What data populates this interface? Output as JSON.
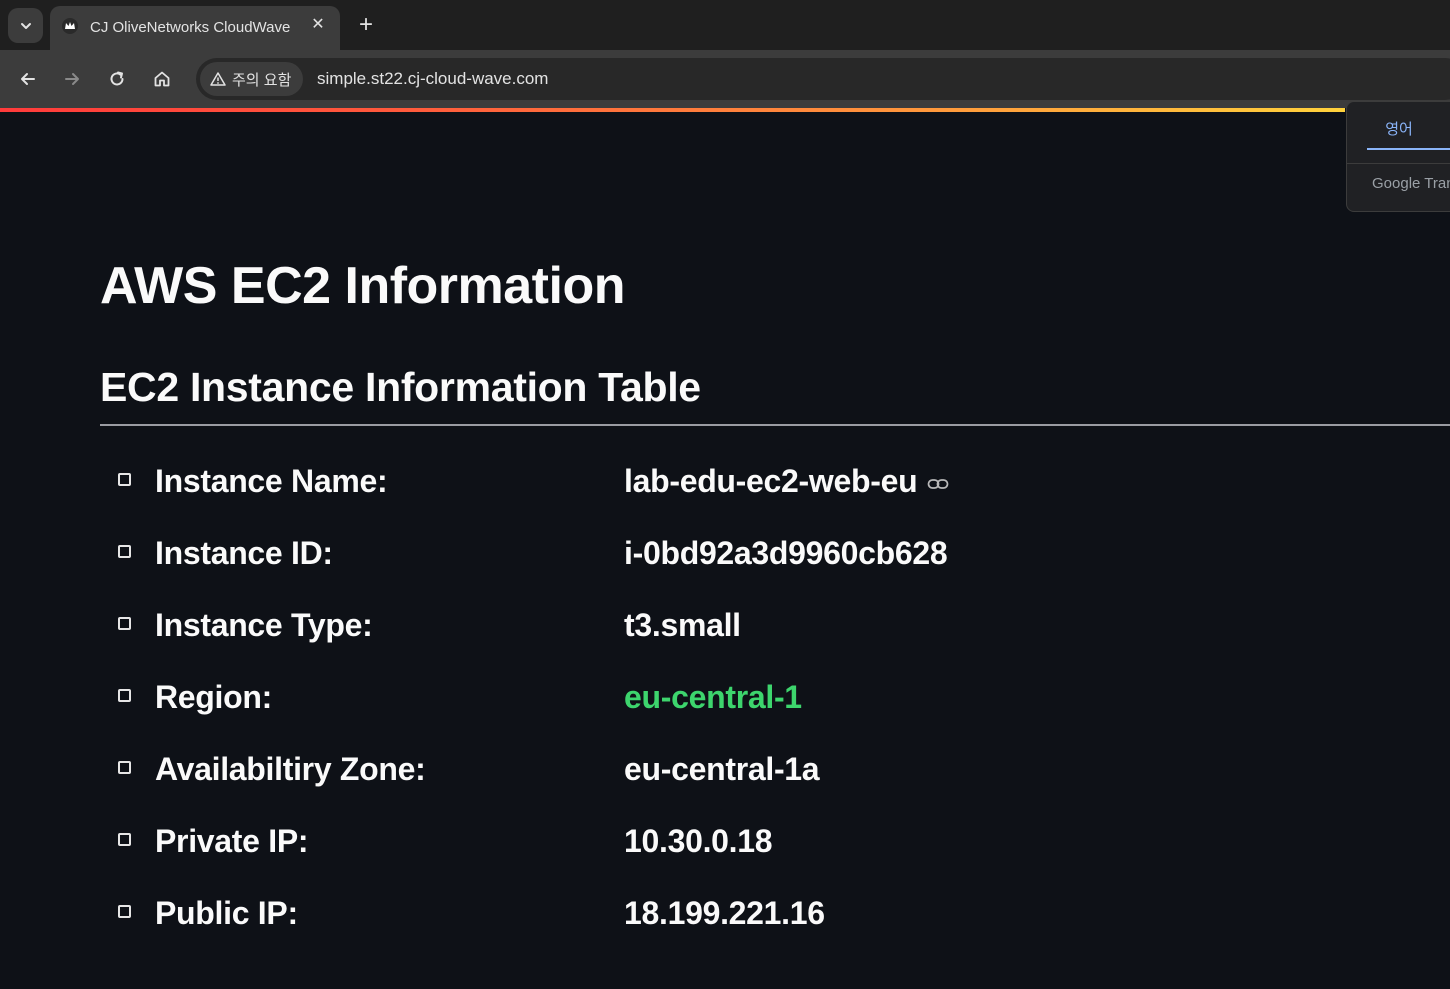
{
  "browser": {
    "tab_title": "CJ OliveNetworks CloudWave",
    "new_tab_label": "+",
    "close_label": "✕",
    "security_chip": "주의 요함",
    "url": "simple.st22.cj-cloud-wave.com"
  },
  "translate_popup": {
    "language": "영어",
    "brand": "Google Translate"
  },
  "page": {
    "title": "AWS EC2 Information",
    "section_title": "EC2 Instance Information Table",
    "rows": [
      {
        "label": "Instance Name:",
        "value": "lab-edu-ec2-web-eu"
      },
      {
        "label": "Instance ID:",
        "value": "i-0bd92a3d9960cb628"
      },
      {
        "label": "Instance Type:",
        "value": "t3.small"
      },
      {
        "label": "Region:",
        "value": "eu-central-1"
      },
      {
        "label": "Availabiltiry Zone:",
        "value": "eu-central-1a"
      },
      {
        "label": "Private IP:",
        "value": "10.30.0.18"
      },
      {
        "label": "Public IP:",
        "value": "18.199.221.16"
      }
    ],
    "highlight_color": "#3dd56d"
  }
}
